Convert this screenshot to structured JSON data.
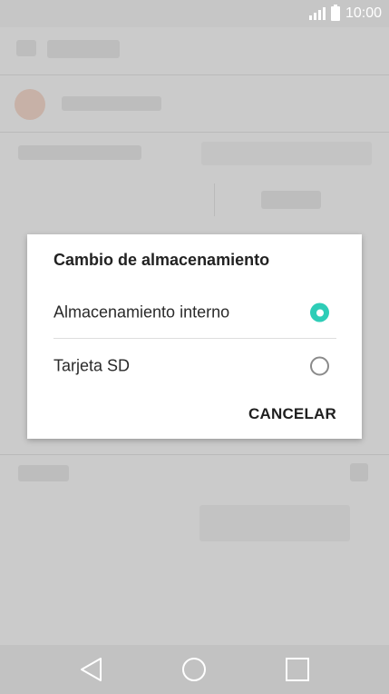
{
  "status_bar": {
    "time": "10:00",
    "signal_icon": "signal-icon",
    "battery_icon": "battery-icon"
  },
  "dialog": {
    "title": "Cambio de almacenamiento",
    "options": [
      {
        "label": "Almacenamiento interno",
        "selected": true
      },
      {
        "label": "Tarjeta SD",
        "selected": false
      }
    ],
    "cancel_label": "CANCELAR",
    "accent_color": "#2ecdb7"
  },
  "nav_bar": {
    "back_icon": "back-icon",
    "home_icon": "home-icon",
    "recents_icon": "recents-icon"
  }
}
